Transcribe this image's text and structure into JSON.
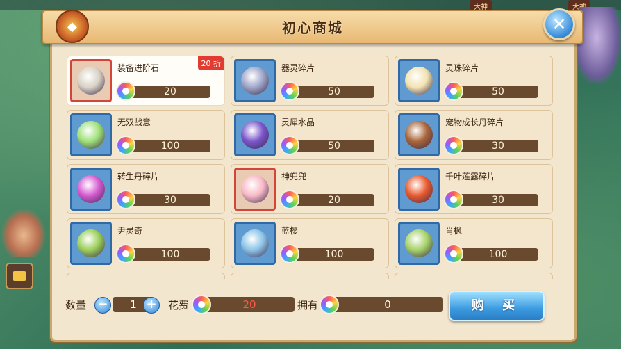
{
  "dialog": {
    "title": "初心商城",
    "close_icon": "close-icon"
  },
  "items": [
    {
      "name": "装备进阶石",
      "price": "20",
      "discount": "20 折",
      "color": "#d9d2c5",
      "frame": "red",
      "selected": true
    },
    {
      "name": "器灵碎片",
      "price": "50",
      "discount": "",
      "color": "#9fa6c9",
      "frame": "blue",
      "selected": false
    },
    {
      "name": "灵珠碎片",
      "price": "50",
      "discount": "",
      "color": "#f2e3b0",
      "frame": "blue",
      "selected": false
    },
    {
      "name": "无双战意",
      "price": "100",
      "discount": "",
      "color": "#9fe07a",
      "frame": "blue",
      "selected": false
    },
    {
      "name": "灵犀水晶",
      "price": "50",
      "discount": "",
      "color": "#7a56c9",
      "frame": "blue",
      "selected": false
    },
    {
      "name": "宠物成长丹碎片",
      "price": "30",
      "discount": "",
      "color": "#a8653a",
      "frame": "blue",
      "selected": false
    },
    {
      "name": "转生丹碎片",
      "price": "30",
      "discount": "",
      "color": "#d45ad0",
      "frame": "blue",
      "selected": false
    },
    {
      "name": "神兜兜",
      "price": "20",
      "discount": "",
      "color": "#f7b9c6",
      "frame": "red",
      "selected": false
    },
    {
      "name": "千叶莲露碎片",
      "price": "30",
      "discount": "",
      "color": "#e85a2e",
      "frame": "blue",
      "selected": false
    },
    {
      "name": "尹灵奇",
      "price": "100",
      "discount": "",
      "color": "#9ccf5a",
      "frame": "blue",
      "selected": false
    },
    {
      "name": "蓝樱",
      "price": "100",
      "discount": "",
      "color": "#8cc4e8",
      "frame": "blue",
      "selected": false
    },
    {
      "name": "肖枫",
      "price": "100",
      "discount": "",
      "color": "#a6d26a",
      "frame": "blue",
      "selected": false
    }
  ],
  "bottom": {
    "quantity_label": "数量",
    "quantity_value": "1",
    "cost_label": "花费",
    "cost_value": "20",
    "owned_label": "拥有",
    "owned_value": "0",
    "buy_label": "购 买",
    "minus_icon": "minus-icon",
    "plus_icon": "plus-icon"
  },
  "background": {
    "tag_1": "大神",
    "tag_2": "大神"
  }
}
